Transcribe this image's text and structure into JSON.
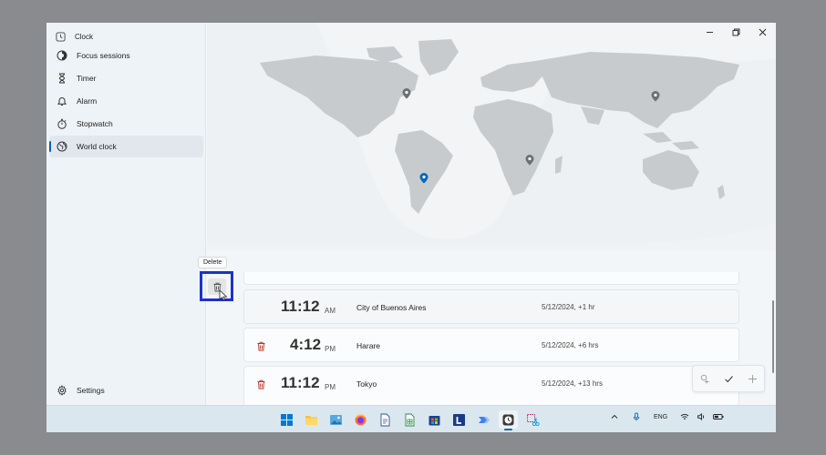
{
  "app": {
    "title": "Clock"
  },
  "sidebar": {
    "items": [
      {
        "label": "Focus sessions",
        "icon": "focus-icon"
      },
      {
        "label": "Timer",
        "icon": "hourglass-icon"
      },
      {
        "label": "Alarm",
        "icon": "bell-icon"
      },
      {
        "label": "Stopwatch",
        "icon": "stopwatch-icon"
      },
      {
        "label": "World clock",
        "icon": "globe-icon",
        "active": true
      }
    ],
    "settings_label": "Settings"
  },
  "tooltip": {
    "text": "Delete"
  },
  "clocks": [
    {
      "time": "11:12",
      "ampm": "AM",
      "city": "City of Buenos Aires",
      "diff": "5/12/2024, +1 hr"
    },
    {
      "time": "4:12",
      "ampm": "PM",
      "city": "Harare",
      "diff": "5/12/2024, +6 hrs"
    },
    {
      "time": "11:12",
      "ampm": "PM",
      "city": "Tokyo",
      "diff": "5/12/2024, +13 hrs"
    }
  ],
  "taskbar": {
    "tray_language": "ENG"
  },
  "colors": {
    "accent": "#0063b1",
    "delete_red": "#c42b1c",
    "highlight": "#1d32c9",
    "map_land": "#c8cbcd",
    "map_night": "#e4e6e8",
    "pin_gray": "#6d6f72",
    "pin_blue": "#0067c0"
  }
}
